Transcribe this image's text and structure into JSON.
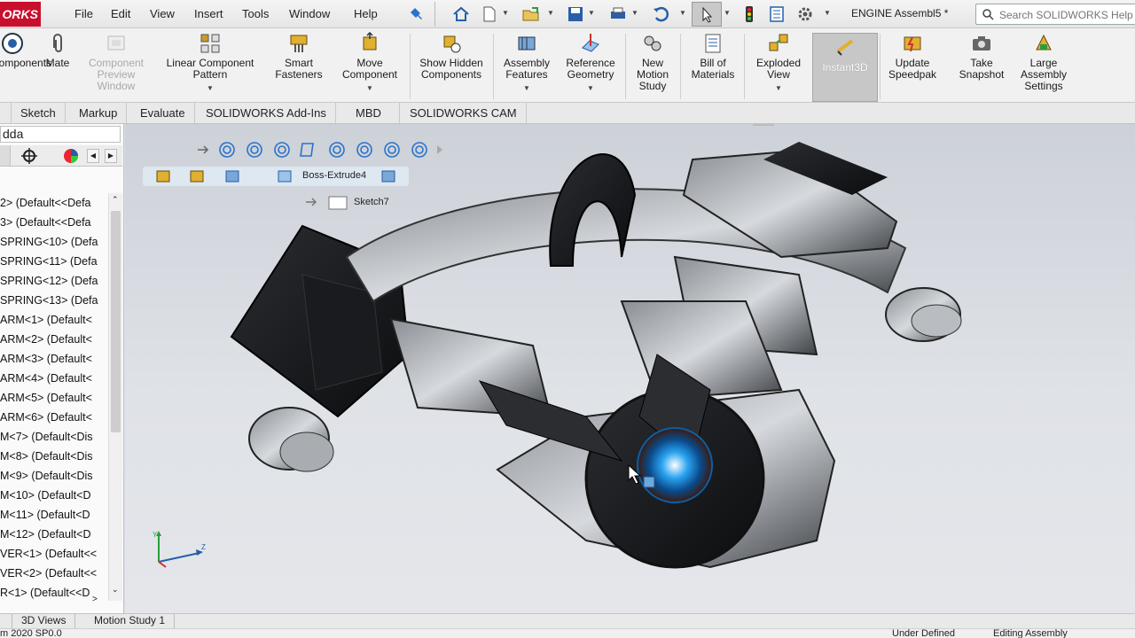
{
  "app": {
    "logo_text": "ORKS",
    "document_title": "ENGINE Assembl5 *"
  },
  "menu": [
    "File",
    "Edit",
    "View",
    "Insert",
    "Tools",
    "Window",
    "Help"
  ],
  "search": {
    "placeholder": "Search SOLIDWORKS Help"
  },
  "commands": {
    "components": "Components",
    "mate": "Mate",
    "component_preview_window": "Component Preview Window",
    "linear_component_pattern": "Linear Component Pattern",
    "smart_fasteners": "Smart Fasteners",
    "move_component": "Move Component",
    "show_hidden_components": "Show Hidden Components",
    "assembly_features": "Assembly Features",
    "reference_geometry": "Reference Geometry",
    "new_motion_study": "New Motion Study",
    "bill_of_materials": "Bill of Materials",
    "exploded_view": "Exploded View",
    "instant3d": "Instant3D",
    "update_speedpak": "Update Speedpak",
    "take_snapshot": "Take Snapshot",
    "large_assembly_settings": "Large Assembly Settings"
  },
  "tabs": [
    "Sketch",
    "Markup",
    "Evaluate",
    "SOLIDWORKS Add-Ins",
    "MBD",
    "SOLIDWORKS CAM"
  ],
  "panel": {
    "filter_text": "dda",
    "tree": [
      "2> (Default<<Defa",
      "3> (Default<<Defa",
      "SPRING<10> (Defa",
      "SPRING<11> (Defa",
      "SPRING<12> (Defa",
      "SPRING<13> (Defa",
      "ARM<1> (Default<",
      "ARM<2> (Default<",
      "ARM<3> (Default<",
      "ARM<4> (Default<",
      "ARM<5> (Default<",
      "ARM<6> (Default<",
      "M<7> (Default<Dis",
      "M<8> (Default<Dis",
      "M<9> (Default<Dis",
      "M<10> (Default<D",
      "M<11> (Default<D",
      "M<12> (Default<D",
      "VER<1> (Default<<",
      "VER<2> (Default<<",
      "R<1> (Default<<D"
    ]
  },
  "viewport": {
    "breadcrumb_feature": "Boss-Extrude4",
    "breadcrumb_sketch": "Sketch7"
  },
  "bottom_tabs": [
    "3D Views",
    "Motion Study 1"
  ],
  "status": {
    "left": "m 2020 SP0.0",
    "middle": "Under Defined",
    "right": "Editing Assembly"
  },
  "colors": {
    "accent_red": "#c8102e",
    "selection_blue": "#1a8fe0"
  }
}
